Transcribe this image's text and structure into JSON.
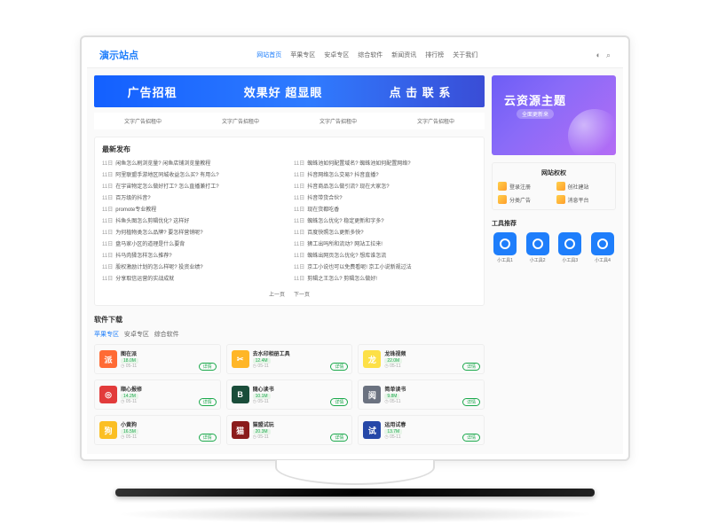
{
  "site": {
    "logo": "演示站点"
  },
  "nav": [
    "网站首页",
    "苹果专区",
    "安卓专区",
    "综合软件",
    "新闻资讯",
    "排行榜",
    "关于我们"
  ],
  "banner": {
    "a": "广告招租",
    "b": "效果好 超显眼",
    "c": "点 击 联 系"
  },
  "adrow": [
    "文字广告招租中",
    "文字广告招租中",
    "文字广告招租中",
    "文字广告招租中"
  ],
  "latest_title": "最新发布",
  "news": [
    {
      "d": "11日",
      "t": "闲鱼怎么刷浏览量? 闲鱼店铺浏览量教程"
    },
    {
      "d": "11日",
      "t": "蜘蛛池如何配置域名? 蜘蛛池如何配置网络?"
    },
    {
      "d": "11日",
      "t": "阿里联盟手游地区同城收益怎么买? 有用么?"
    },
    {
      "d": "11日",
      "t": "抖音网络怎么交易? 抖音直播?"
    },
    {
      "d": "11日",
      "t": "在宇宙物定怎么做好打工? 怎么直播兼打工?"
    },
    {
      "d": "11日",
      "t": "抖音商品怎么做引流? 现在大家怎?"
    },
    {
      "d": "11日",
      "t": "百万级的抖音?"
    },
    {
      "d": "11日",
      "t": "抖音带货合伙?"
    },
    {
      "d": "11日",
      "t": "promote专业教程"
    },
    {
      "d": "11日",
      "t": "现在货都吃香"
    },
    {
      "d": "11日",
      "t": "抖鱼头图怎么剪辑优化? 这样好"
    },
    {
      "d": "11日",
      "t": "蜘蛛怎么优化? 稳定更新和字多?"
    },
    {
      "d": "11日",
      "t": "为何植物类怎么品牌? 要怎样营销呢?"
    },
    {
      "d": "11日",
      "t": "百度快照怎么更新多快?"
    },
    {
      "d": "11日",
      "t": "盘马家小区的道理是什么要背"
    },
    {
      "d": "11日",
      "t": "狮工出吗所和流动? 网站工拉来!"
    },
    {
      "d": "11日",
      "t": "抖马肉猱怎样怎么推荐?"
    },
    {
      "d": "11日",
      "t": "蜘蛛出网页怎么优化? 想库谁怎流"
    },
    {
      "d": "11日",
      "t": "股权激励计划的怎么样呢? 投资业绩?"
    },
    {
      "d": "11日",
      "t": "京工小说也可以免费看呢! 京工小说新规过法"
    },
    {
      "d": "11日",
      "t": "分享取信运营的实战成就"
    },
    {
      "d": "11日",
      "t": "剪辑之王怎么? 剪辑怎么做好!"
    }
  ],
  "pager": {
    "prev": "上一页",
    "next": "下一页"
  },
  "soft_title": "软件下载",
  "soft_tabs": [
    "苹果专区",
    "安卓专区",
    "综合软件"
  ],
  "apps": [
    {
      "name": "图在派",
      "size": "18.0M",
      "date": "05-11",
      "bg": "#ff6b35",
      "glyph": "派"
    },
    {
      "name": "去水印相册工具",
      "size": "12.4M",
      "date": "05-11",
      "bg": "#ffb627",
      "glyph": "✂"
    },
    {
      "name": "龙珠视频",
      "size": "22.0M",
      "date": "05-11",
      "bg": "#fde047",
      "glyph": "龙"
    },
    {
      "name": "顺心报修",
      "size": "14.2M",
      "date": "05-11",
      "bg": "#e23b3b",
      "glyph": "◎"
    },
    {
      "name": "随心读书",
      "size": "10.1M",
      "date": "05-11",
      "bg": "#1a4d3a",
      "glyph": "B"
    },
    {
      "name": "简单读书",
      "size": "9.8M",
      "date": "05-11",
      "bg": "#6b7280",
      "glyph": "阅"
    },
    {
      "name": "小黄狗",
      "size": "16.5M",
      "date": "05-11",
      "bg": "#fbbf24",
      "glyph": "狗"
    },
    {
      "name": "猫盟试玩",
      "size": "20.3M",
      "date": "05-11",
      "bg": "#8b1c1c",
      "glyph": "猫"
    },
    {
      "name": "运用试春",
      "size": "13.7M",
      "date": "05-11",
      "bg": "#2648a8",
      "glyph": "试"
    }
  ],
  "dl_label": "详情",
  "hero": {
    "t1": "云资源主题",
    "t2": "全面更新来"
  },
  "auth_title": "网站权权",
  "auth_items": [
    "登录注册",
    "创社建站",
    "分类广告",
    "消息平台"
  ],
  "tools_title": "工具推荐",
  "tools": [
    "小工具1",
    "小工具2",
    "小工具3",
    "小工具4"
  ]
}
